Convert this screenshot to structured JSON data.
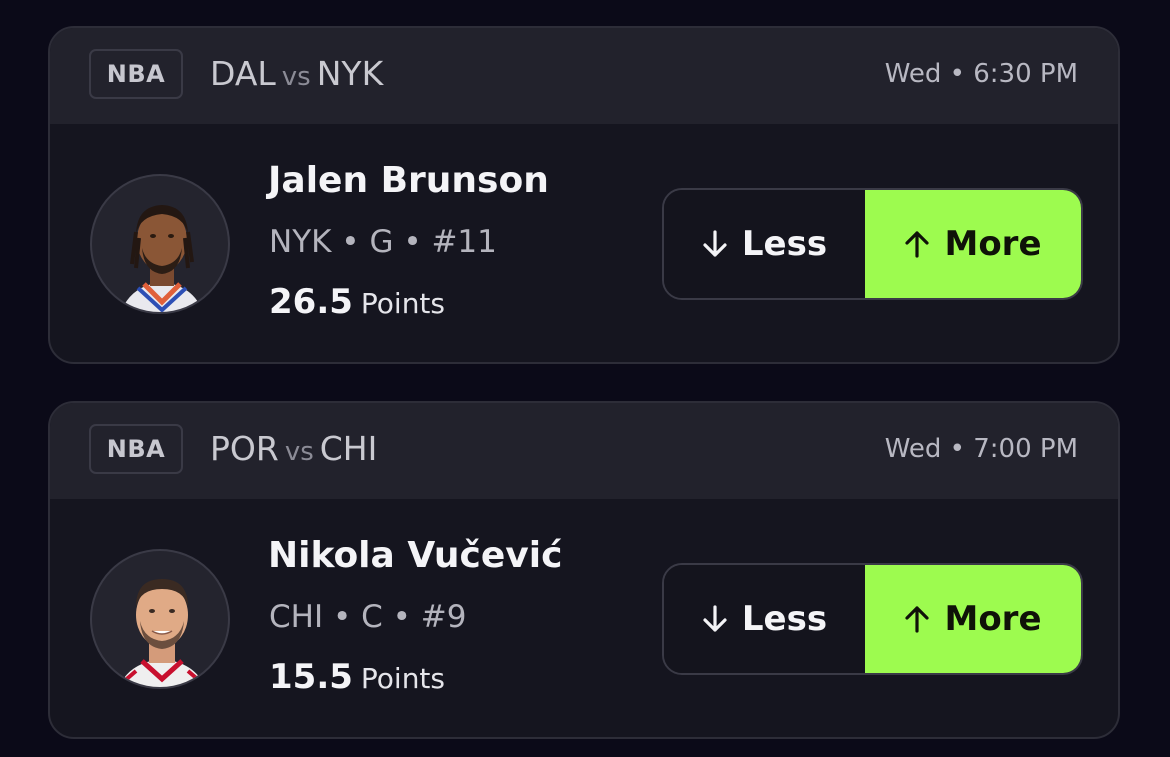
{
  "cards": [
    {
      "league": "NBA",
      "team_a": "DAL",
      "vs": "vs",
      "team_b": "NYK",
      "time": "Wed • 6:30 PM",
      "player": {
        "name": "Jalen Brunson",
        "meta": "NYK • G • #11",
        "line_value": "26.5",
        "line_stat": "Points"
      },
      "less_label": "Less",
      "more_label": "More"
    },
    {
      "league": "NBA",
      "team_a": "POR",
      "vs": "vs",
      "team_b": "CHI",
      "time": "Wed • 7:00 PM",
      "player": {
        "name": "Nikola Vučević",
        "meta": "CHI • C • #9",
        "line_value": "15.5",
        "line_stat": "Points"
      },
      "less_label": "Less",
      "more_label": "More"
    }
  ],
  "colors": {
    "more_accent": "#9dfb4f",
    "background": "#0b0a18",
    "card": "#15151f"
  },
  "icons": {
    "less": "arrow-down-icon",
    "more": "arrow-up-icon"
  }
}
